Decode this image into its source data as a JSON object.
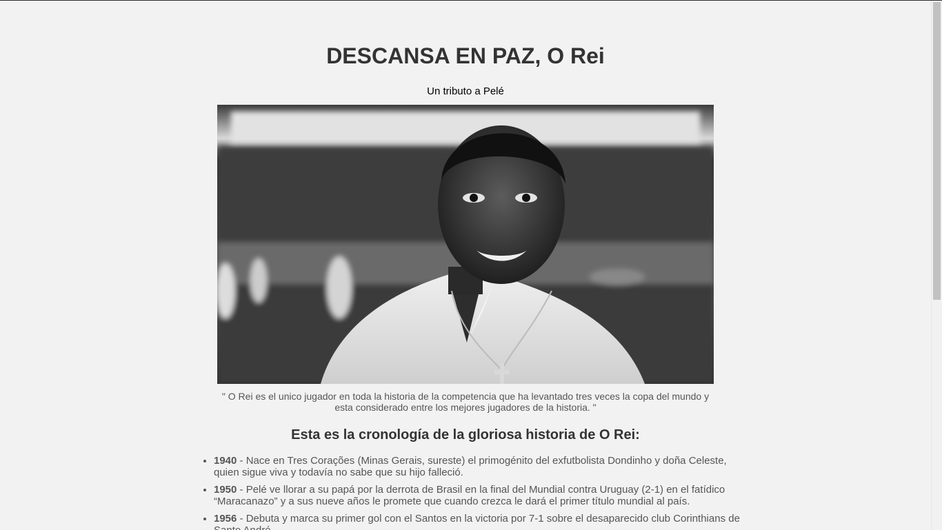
{
  "header": {
    "title": "DESCANSA EN PAZ, O Rei",
    "subtitle": "Un tributo a Pelé"
  },
  "photo": {
    "alt": "Pelé sonriendo",
    "caption": "\" O Rei es el unico jugador en toda la historia de la competencia que ha levantado tres veces la copa del mundo y esta considerado entre los mejores jugadores de la historia. \""
  },
  "timeline": {
    "heading": "Esta es la cronología de la gloriosa historia de O Rei:",
    "items": [
      {
        "year": "1940",
        "text": " - Nace en Tres Corações (Minas Gerais, sureste) el primogénito del exfutbolista Dondinho y doña Celeste, quien sigue viva y todavía no sabe que su hijo falleció."
      },
      {
        "year": "1950",
        "text": " - Pelé ve llorar a su papá por la derrota de Brasil en la final del Mundial contra Uruguay (2-1) en el fatídico “Maracanazo” y a sus nueve años le promete que cuando crezca le dará el primer título mundial al país."
      },
      {
        "year": "1956",
        "text": " - Debuta y marca su primer gol con el Santos en la victoria por 7-1 sobre el desaparecido club Corinthians de Santo André."
      }
    ]
  },
  "colors": {
    "background": "#f2f2f2",
    "title": "#333333",
    "body_text": "#555555"
  }
}
